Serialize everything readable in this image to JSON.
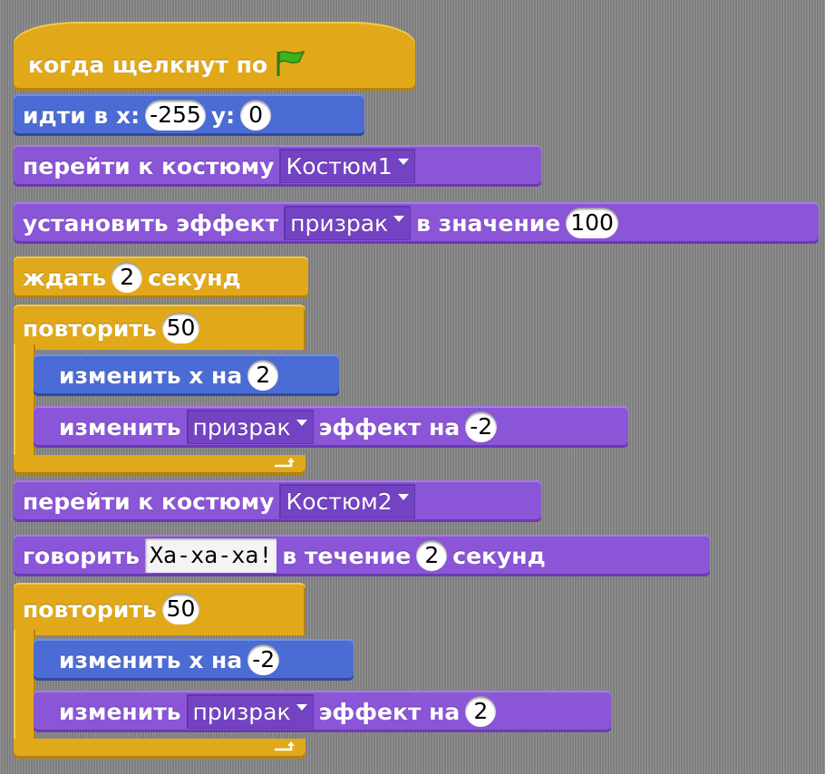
{
  "script": {
    "hat": {
      "label": "когда щелкнут по",
      "flag_icon": "green-flag-icon"
    },
    "goto": {
      "pre": "идти в x:",
      "x": "-255",
      "mid": "y:",
      "y": "0"
    },
    "switch1": {
      "label": "перейти к костюму",
      "costume": "Костюм1"
    },
    "seteffect": {
      "pre": "установить эффект",
      "effect": "призрак",
      "mid": "в значение",
      "value": "100"
    },
    "wait": {
      "pre": "ждать",
      "value": "2",
      "post": "секунд"
    },
    "repeat1": {
      "label": "повторить",
      "count": "50",
      "changex": {
        "label": "изменить x на",
        "value": "2"
      },
      "changeeffect": {
        "pre": "изменить",
        "effect": "призрак",
        "mid": "эффект на",
        "value": "-2"
      }
    },
    "switch2": {
      "label": "перейти к костюму",
      "costume": "Костюм2"
    },
    "say": {
      "pre": "говорить",
      "text": "Ха-ха-ха!",
      "mid": "в течение",
      "value": "2",
      "post": "секунд"
    },
    "repeat2": {
      "label": "повторить",
      "count": "50",
      "changex": {
        "label": "изменить x на",
        "value": "-2"
      },
      "changeeffect": {
        "pre": "изменить",
        "effect": "призрак",
        "mid": "эффект на",
        "value": "2"
      }
    }
  },
  "colors": {
    "motion": "#4a6cd4",
    "looks": "#8a55d7",
    "control": "#e1a91a",
    "flag": "#3fb21c"
  }
}
